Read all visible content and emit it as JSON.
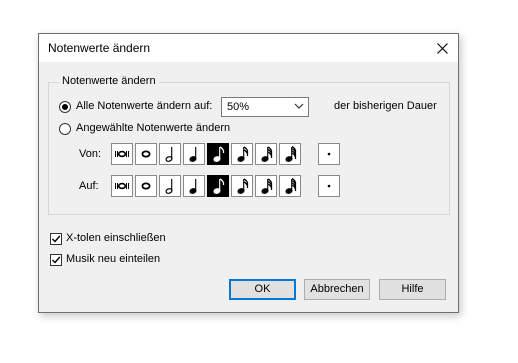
{
  "window": {
    "title": "Notenwerte ändern"
  },
  "group": {
    "label": "Notenwerte ändern"
  },
  "option_all": {
    "label": "Alle Notenwerte ändern auf:",
    "selected": true
  },
  "percent": {
    "value": "50%"
  },
  "suffix": "der bisherigen Dauer",
  "option_selected": {
    "label": "Angewählte Notenwerte ändern",
    "selected": false
  },
  "von_label": "Von:",
  "auf_label": "Auf:",
  "note_values": [
    {
      "icon": "breve-icon",
      "name": "breve",
      "selected": false
    },
    {
      "icon": "whole-note-icon",
      "name": "whole",
      "selected": false
    },
    {
      "icon": "half-note-icon",
      "name": "half",
      "selected": false
    },
    {
      "icon": "quarter-note-icon",
      "name": "quarter",
      "selected": false
    },
    {
      "icon": "eighth-note-icon",
      "name": "eighth",
      "selected": true
    },
    {
      "icon": "sixteenth-note-icon",
      "name": "sixteenth",
      "selected": false
    },
    {
      "icon": "thirtysecond-note-icon",
      "name": "thirty-second",
      "selected": false
    },
    {
      "icon": "sixtyfourth-note-icon",
      "name": "sixty-fourth",
      "selected": false
    }
  ],
  "dot": {
    "icon": "dot-icon"
  },
  "checkbox_tuplets": {
    "label": "X-tolen einschließen",
    "checked": true
  },
  "checkbox_rebar": {
    "label": "Musik neu einteilen",
    "checked": true
  },
  "buttons": {
    "ok": "OK",
    "cancel": "Abbrechen",
    "help": "Hilfe"
  }
}
